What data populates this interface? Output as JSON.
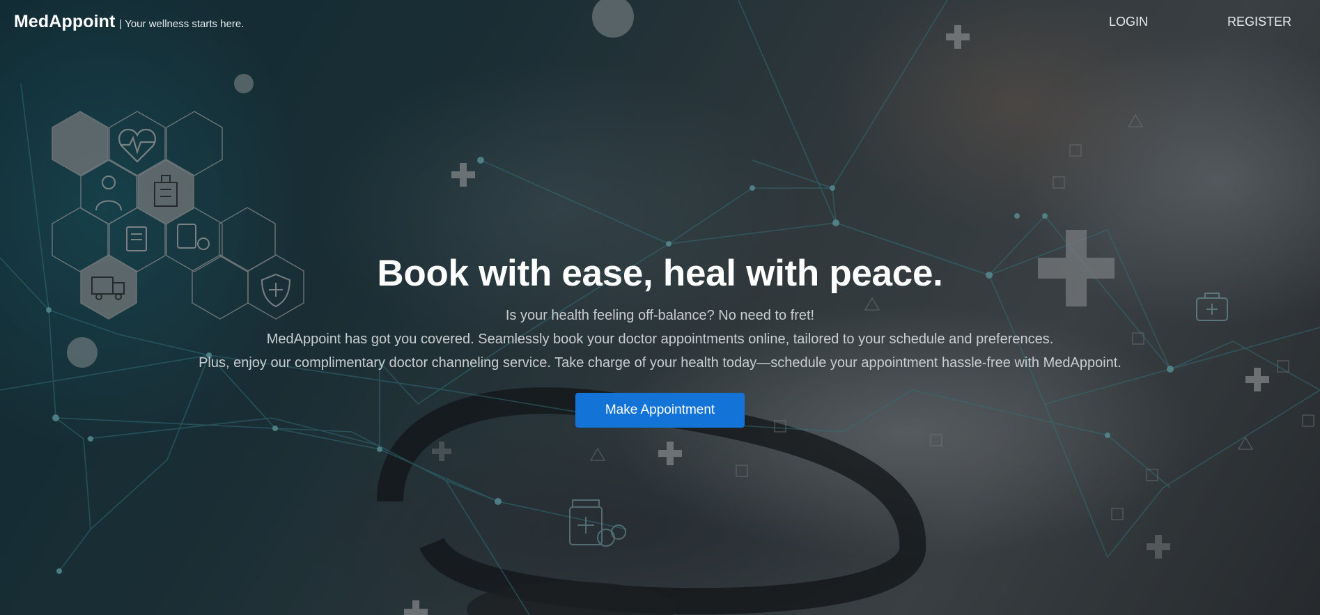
{
  "brand": {
    "name": "MedAppoint",
    "tagline": "| Your wellness starts here."
  },
  "nav": {
    "login_label": "LOGIN",
    "register_label": "REGISTER"
  },
  "hero": {
    "title": "Book with ease, heal with peace.",
    "lines": [
      "Is your health feeling off-balance? No need to fret!",
      "MedAppoint has got you covered. Seamlessly book your doctor appointments online, tailored to your schedule and preferences.",
      "Plus, enjoy our complimentary doctor channeling service. Take charge of your health today—schedule your appointment hassle-free with MedAppoint."
    ],
    "cta_label": "Make Appointment"
  },
  "colors": {
    "accent": "#1473d6",
    "text_primary": "#ffffff",
    "text_secondary": "#c9ced2",
    "network_lines": "#4fb3c4"
  },
  "icons": [
    "heart-rate-icon",
    "doctor-icon",
    "hospital-icon",
    "medical-report-icon",
    "pharmacy-icon",
    "ambulance-icon",
    "shield-cross-icon",
    "medical-cross-icon",
    "first-aid-kit-icon",
    "medicine-bottle-icon"
  ]
}
